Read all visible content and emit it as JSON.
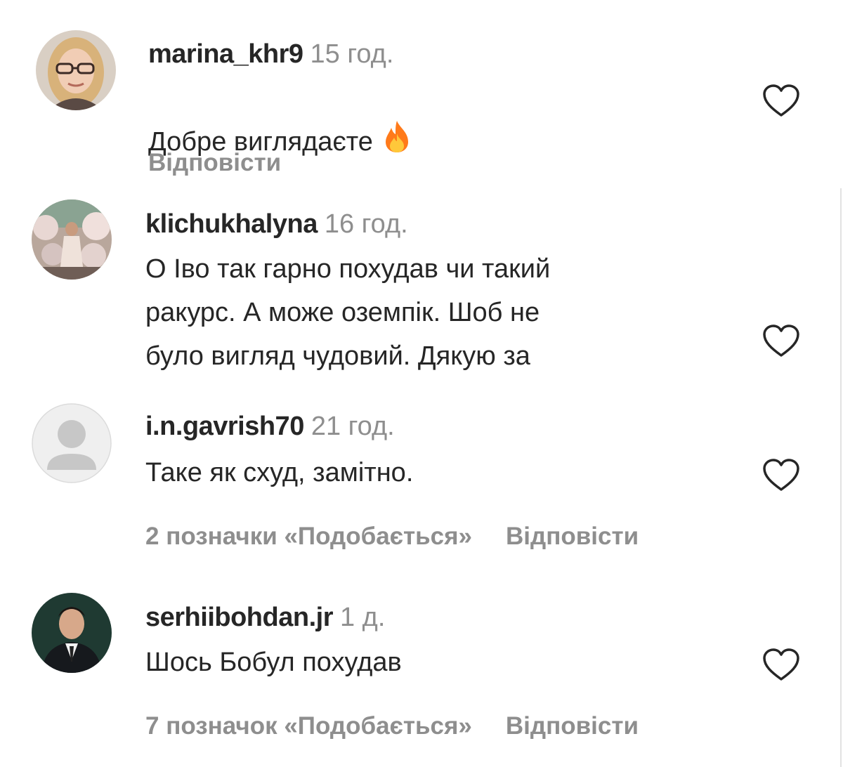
{
  "comments": [
    {
      "username": "marina_khr9",
      "time": "15 год.",
      "text": "Добре виглядаєте",
      "emoji": "fire-icon",
      "likes": "",
      "reply": "Відповісти",
      "avatar": "photo-woman-glasses"
    },
    {
      "username": "klichukhalyna",
      "time": "16 год.",
      "text": "О Іво так гарно похудав чи такий\nракурс. А може оземпік. Шоб не\nбуло вигляд чудовий. Дякую за",
      "avatar": "photo-woman-decor"
    },
    {
      "username": "i.n.gavrish70",
      "time": "21 год.",
      "text": "Таке як схуд, замітно.",
      "likes": "2 позначки «Подобається»",
      "reply": "Відповісти",
      "avatar": "default-user-icon"
    },
    {
      "username": "serhiibohdan.jr",
      "time": "1 д.",
      "text": "Шось Бобул похудав",
      "likes": "7 позначок «Подобається»",
      "reply": "Відповісти",
      "avatar": "photo-man-suit"
    }
  ],
  "colors": {
    "text": "#262626",
    "secondary": "#8e8e8e",
    "heart_stroke": "#262626",
    "default_avatar_bg": "#efefef",
    "default_avatar_fg": "#c7c7c7",
    "fire": "#ff5a1f"
  }
}
